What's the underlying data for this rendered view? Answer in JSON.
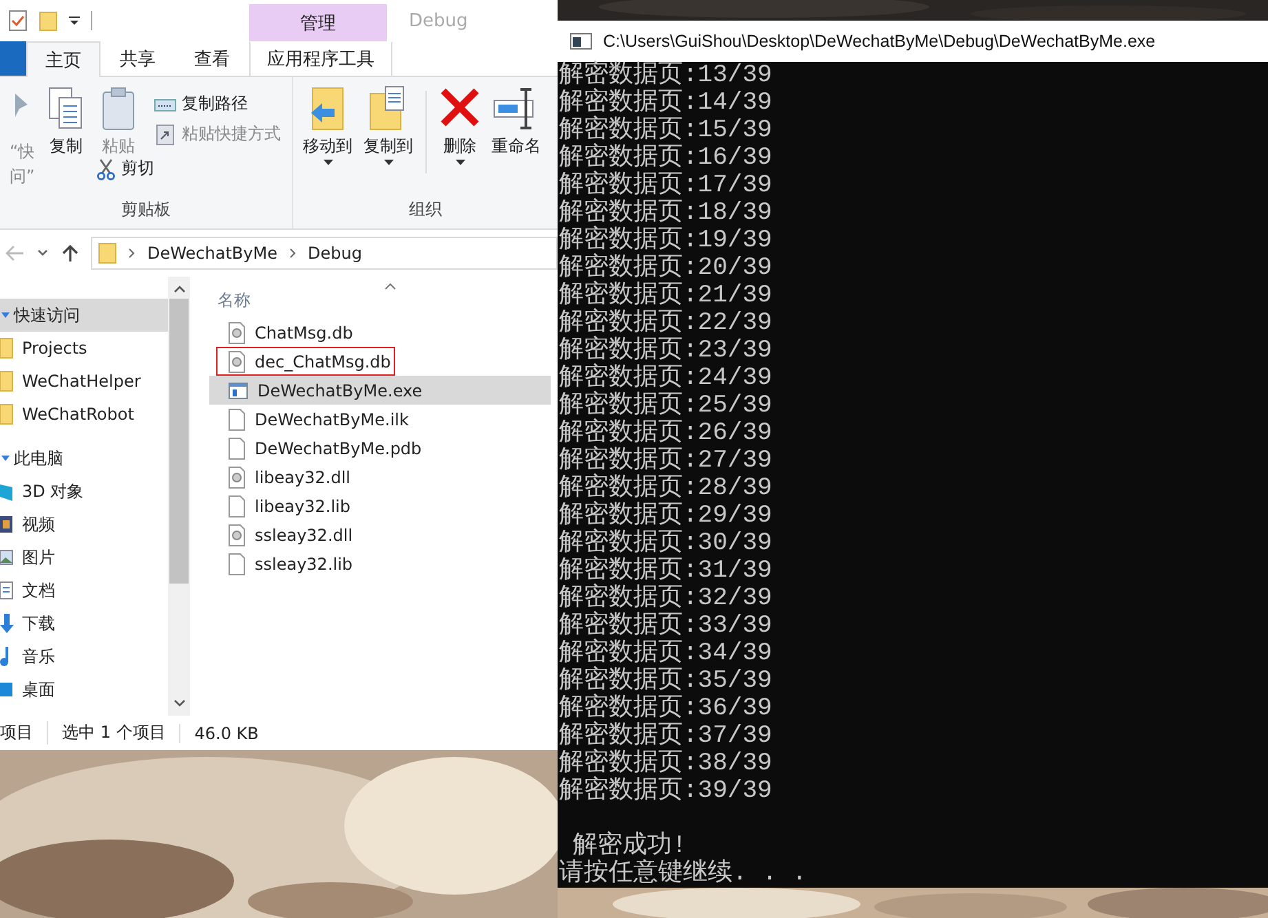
{
  "explorer": {
    "context_tab": {
      "group": "管理",
      "title": "Debug"
    },
    "tabs": [
      {
        "label": "主页",
        "selected": true
      },
      {
        "label": "共享",
        "selected": false
      },
      {
        "label": "查看",
        "selected": false
      },
      {
        "label": "应用程序工具",
        "selected": false
      }
    ],
    "ribbon_groups": [
      {
        "label": "剪贴板",
        "buttons": [
          {
            "lines": [
              "“快",
              "问”"
            ],
            "disabled": true
          },
          {
            "label": "复制",
            "disabled": false
          },
          {
            "label": "粘贴",
            "disabled": true
          },
          {
            "label": "复制路径",
            "disabled": false
          },
          {
            "label": "粘贴快捷方式",
            "disabled": true
          },
          {
            "label": "剪切",
            "disabled": false
          }
        ]
      },
      {
        "label": "组织",
        "buttons": [
          {
            "label": "移动到",
            "disabled": false,
            "dropdown": true
          },
          {
            "label": "复制到",
            "disabled": false,
            "dropdown": true
          },
          {
            "label": "删除",
            "disabled": false,
            "dropdown": true
          },
          {
            "label": "重命名",
            "disabled": false,
            "dropdown": false
          }
        ]
      }
    ],
    "path": [
      "DeWechatByMe",
      "Debug"
    ],
    "nav": [
      {
        "label": "快速访问",
        "expanded": true,
        "selected": true,
        "children": [
          {
            "label": "Projects",
            "selected": false
          },
          {
            "label": "WeChatHelper",
            "selected": false
          },
          {
            "label": "WeChatRobot",
            "selected": false
          }
        ]
      },
      {
        "label": "此电脑",
        "expanded": true,
        "selected": false,
        "children": [
          {
            "label": "3D 对象",
            "selected": false
          },
          {
            "label": "视频",
            "selected": false
          },
          {
            "label": "图片",
            "selected": false
          },
          {
            "label": "文档",
            "selected": false
          },
          {
            "label": "下载",
            "selected": false
          },
          {
            "label": "音乐",
            "selected": false
          },
          {
            "label": "桌面",
            "selected": false
          }
        ]
      }
    ],
    "column_header": "名称",
    "files": [
      {
        "name": "ChatMsg.db",
        "kind": "db",
        "selected": false,
        "outlined": false
      },
      {
        "name": "dec_ChatMsg.db",
        "kind": "db",
        "selected": false,
        "outlined": true
      },
      {
        "name": "DeWechatByMe.exe",
        "kind": "exe",
        "selected": true,
        "outlined": false
      },
      {
        "name": "DeWechatByMe.ilk",
        "kind": "blank",
        "selected": false,
        "outlined": false
      },
      {
        "name": "DeWechatByMe.pdb",
        "kind": "blank",
        "selected": false,
        "outlined": false
      },
      {
        "name": "libeay32.dll",
        "kind": "db",
        "selected": false,
        "outlined": false
      },
      {
        "name": "libeay32.lib",
        "kind": "blank",
        "selected": false,
        "outlined": false
      },
      {
        "name": "ssleay32.dll",
        "kind": "db",
        "selected": false,
        "outlined": false
      },
      {
        "name": "ssleay32.lib",
        "kind": "blank",
        "selected": false,
        "outlined": false
      }
    ],
    "status_bar": [
      "项目",
      "选中 1 个项目",
      "46.0 KB"
    ]
  },
  "console": {
    "title": "C:\\Users\\GuiShou\\Desktop\\DeWechatByMe\\Debug\\DeWechatByMe.exe",
    "lines": [
      "解密数据页:13/39",
      "解密数据页:14/39",
      "解密数据页:15/39",
      "解密数据页:16/39",
      "解密数据页:17/39",
      "解密数据页:18/39",
      "解密数据页:19/39",
      "解密数据页:20/39",
      "解密数据页:21/39",
      "解密数据页:22/39",
      "解密数据页:23/39",
      "解密数据页:24/39",
      "解密数据页:25/39",
      "解密数据页:26/39",
      "解密数据页:27/39",
      "解密数据页:28/39",
      "解密数据页:29/39",
      "解密数据页:30/39",
      "解密数据页:31/39",
      "解密数据页:32/39",
      "解密数据页:33/39",
      "解密数据页:34/39",
      "解密数据页:35/39",
      "解密数据页:36/39",
      "解密数据页:37/39",
      "解密数据页:38/39",
      "解密数据页:39/39"
    ],
    "result": "解密成功!",
    "prompt": "请按任意键继续. . ."
  }
}
